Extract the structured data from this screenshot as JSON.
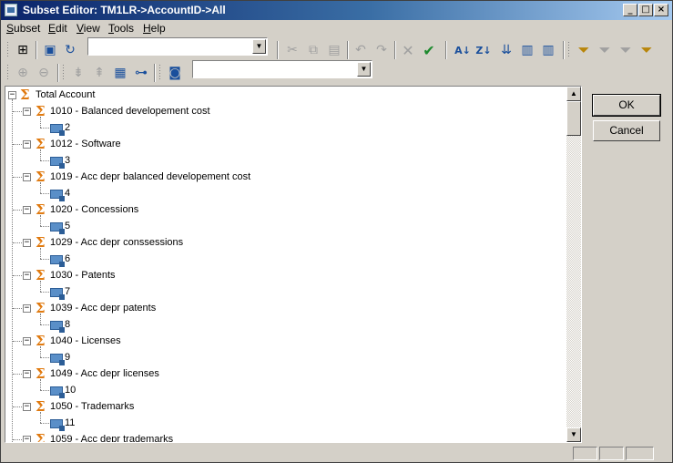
{
  "window": {
    "title": "Subset Editor:  TM1LR->AccountID->All",
    "controls": {
      "minimize": "_",
      "maximize": "□",
      "close": "×"
    }
  },
  "menu": [
    {
      "label": "Subset",
      "key": "S",
      "rest": "ubset"
    },
    {
      "label": "Edit",
      "key": "E",
      "rest": "dit"
    },
    {
      "label": "View",
      "key": "V",
      "rest": "iew"
    },
    {
      "label": "Tools",
      "key": "T",
      "rest": "ools"
    },
    {
      "label": "Help",
      "key": "H",
      "rest": "elp"
    }
  ],
  "toolbar1": {
    "subset_combo_value": "",
    "icons": [
      "subset-all-icon",
      "save-icon",
      "refresh-icon",
      "cut-icon",
      "copy-icon",
      "paste-icon",
      "undo-icon",
      "redo-icon",
      "delete-icon",
      "keep-icon",
      "sort-asc-icon",
      "sort-desc-icon",
      "sort-hierarchy-icon",
      "sort-index-asc-icon",
      "sort-index-desc-icon",
      "filter-icon",
      "filter-attribute-icon",
      "filter-level-icon",
      "filter-wildcard-icon"
    ]
  },
  "toolbar2": {
    "alias_combo_value": "",
    "icons": [
      "expand-icon",
      "collapse-icon",
      "drilldown-icon",
      "rollup-icon",
      "select-all-icon",
      "tree-icon",
      "alias-icon"
    ]
  },
  "tree": {
    "root": {
      "label": "Total Account"
    },
    "groups": [
      {
        "label": "1010 - Balanced developement cost",
        "child": "2"
      },
      {
        "label": "1012 - Software",
        "child": "3"
      },
      {
        "label": "1019 - Acc depr balanced developement cost",
        "child": "4"
      },
      {
        "label": "1020 - Concessions",
        "child": "5"
      },
      {
        "label": "1029 - Acc depr conssessions",
        "child": "6"
      },
      {
        "label": "1030 - Patents",
        "child": "7"
      },
      {
        "label": "1039 - Acc depr patents",
        "child": "8"
      },
      {
        "label": "1040 - Licenses",
        "child": "9"
      },
      {
        "label": "1049 - Acc depr licenses",
        "child": "10"
      },
      {
        "label": "1050 - Trademarks",
        "child": "11"
      },
      {
        "label": "1059 - Acc depr trademarks",
        "child": ""
      }
    ]
  },
  "buttons": {
    "ok": "OK",
    "cancel": "Cancel"
  },
  "colors": {
    "title_start": "#0a246a",
    "title_end": "#a6caf0",
    "sigma": "#e07a10",
    "leaf": "#5a8fc8"
  }
}
